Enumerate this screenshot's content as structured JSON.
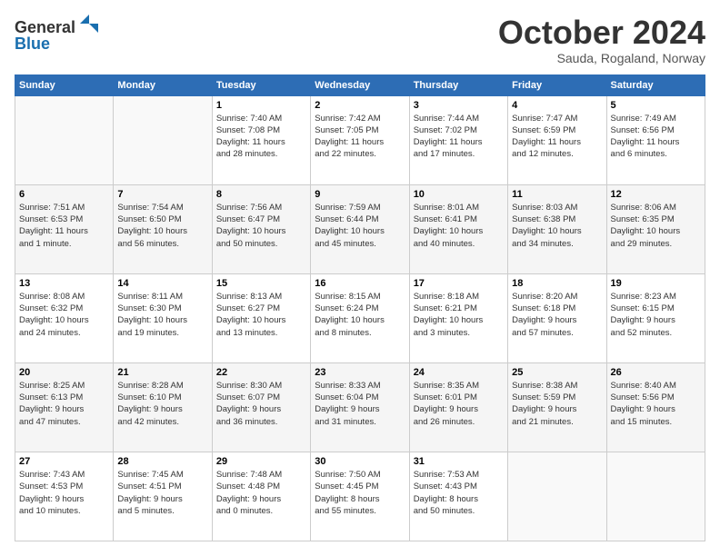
{
  "logo": {
    "line1": "General",
    "line2": "Blue"
  },
  "header": {
    "month": "October 2024",
    "location": "Sauda, Rogaland, Norway"
  },
  "weekdays": [
    "Sunday",
    "Monday",
    "Tuesday",
    "Wednesday",
    "Thursday",
    "Friday",
    "Saturday"
  ],
  "weeks": [
    [
      {
        "day": "",
        "info": ""
      },
      {
        "day": "",
        "info": ""
      },
      {
        "day": "1",
        "info": "Sunrise: 7:40 AM\nSunset: 7:08 PM\nDaylight: 11 hours\nand 28 minutes."
      },
      {
        "day": "2",
        "info": "Sunrise: 7:42 AM\nSunset: 7:05 PM\nDaylight: 11 hours\nand 22 minutes."
      },
      {
        "day": "3",
        "info": "Sunrise: 7:44 AM\nSunset: 7:02 PM\nDaylight: 11 hours\nand 17 minutes."
      },
      {
        "day": "4",
        "info": "Sunrise: 7:47 AM\nSunset: 6:59 PM\nDaylight: 11 hours\nand 12 minutes."
      },
      {
        "day": "5",
        "info": "Sunrise: 7:49 AM\nSunset: 6:56 PM\nDaylight: 11 hours\nand 6 minutes."
      }
    ],
    [
      {
        "day": "6",
        "info": "Sunrise: 7:51 AM\nSunset: 6:53 PM\nDaylight: 11 hours\nand 1 minute."
      },
      {
        "day": "7",
        "info": "Sunrise: 7:54 AM\nSunset: 6:50 PM\nDaylight: 10 hours\nand 56 minutes."
      },
      {
        "day": "8",
        "info": "Sunrise: 7:56 AM\nSunset: 6:47 PM\nDaylight: 10 hours\nand 50 minutes."
      },
      {
        "day": "9",
        "info": "Sunrise: 7:59 AM\nSunset: 6:44 PM\nDaylight: 10 hours\nand 45 minutes."
      },
      {
        "day": "10",
        "info": "Sunrise: 8:01 AM\nSunset: 6:41 PM\nDaylight: 10 hours\nand 40 minutes."
      },
      {
        "day": "11",
        "info": "Sunrise: 8:03 AM\nSunset: 6:38 PM\nDaylight: 10 hours\nand 34 minutes."
      },
      {
        "day": "12",
        "info": "Sunrise: 8:06 AM\nSunset: 6:35 PM\nDaylight: 10 hours\nand 29 minutes."
      }
    ],
    [
      {
        "day": "13",
        "info": "Sunrise: 8:08 AM\nSunset: 6:32 PM\nDaylight: 10 hours\nand 24 minutes."
      },
      {
        "day": "14",
        "info": "Sunrise: 8:11 AM\nSunset: 6:30 PM\nDaylight: 10 hours\nand 19 minutes."
      },
      {
        "day": "15",
        "info": "Sunrise: 8:13 AM\nSunset: 6:27 PM\nDaylight: 10 hours\nand 13 minutes."
      },
      {
        "day": "16",
        "info": "Sunrise: 8:15 AM\nSunset: 6:24 PM\nDaylight: 10 hours\nand 8 minutes."
      },
      {
        "day": "17",
        "info": "Sunrise: 8:18 AM\nSunset: 6:21 PM\nDaylight: 10 hours\nand 3 minutes."
      },
      {
        "day": "18",
        "info": "Sunrise: 8:20 AM\nSunset: 6:18 PM\nDaylight: 9 hours\nand 57 minutes."
      },
      {
        "day": "19",
        "info": "Sunrise: 8:23 AM\nSunset: 6:15 PM\nDaylight: 9 hours\nand 52 minutes."
      }
    ],
    [
      {
        "day": "20",
        "info": "Sunrise: 8:25 AM\nSunset: 6:13 PM\nDaylight: 9 hours\nand 47 minutes."
      },
      {
        "day": "21",
        "info": "Sunrise: 8:28 AM\nSunset: 6:10 PM\nDaylight: 9 hours\nand 42 minutes."
      },
      {
        "day": "22",
        "info": "Sunrise: 8:30 AM\nSunset: 6:07 PM\nDaylight: 9 hours\nand 36 minutes."
      },
      {
        "day": "23",
        "info": "Sunrise: 8:33 AM\nSunset: 6:04 PM\nDaylight: 9 hours\nand 31 minutes."
      },
      {
        "day": "24",
        "info": "Sunrise: 8:35 AM\nSunset: 6:01 PM\nDaylight: 9 hours\nand 26 minutes."
      },
      {
        "day": "25",
        "info": "Sunrise: 8:38 AM\nSunset: 5:59 PM\nDaylight: 9 hours\nand 21 minutes."
      },
      {
        "day": "26",
        "info": "Sunrise: 8:40 AM\nSunset: 5:56 PM\nDaylight: 9 hours\nand 15 minutes."
      }
    ],
    [
      {
        "day": "27",
        "info": "Sunrise: 7:43 AM\nSunset: 4:53 PM\nDaylight: 9 hours\nand 10 minutes."
      },
      {
        "day": "28",
        "info": "Sunrise: 7:45 AM\nSunset: 4:51 PM\nDaylight: 9 hours\nand 5 minutes."
      },
      {
        "day": "29",
        "info": "Sunrise: 7:48 AM\nSunset: 4:48 PM\nDaylight: 9 hours\nand 0 minutes."
      },
      {
        "day": "30",
        "info": "Sunrise: 7:50 AM\nSunset: 4:45 PM\nDaylight: 8 hours\nand 55 minutes."
      },
      {
        "day": "31",
        "info": "Sunrise: 7:53 AM\nSunset: 4:43 PM\nDaylight: 8 hours\nand 50 minutes."
      },
      {
        "day": "",
        "info": ""
      },
      {
        "day": "",
        "info": ""
      }
    ]
  ]
}
